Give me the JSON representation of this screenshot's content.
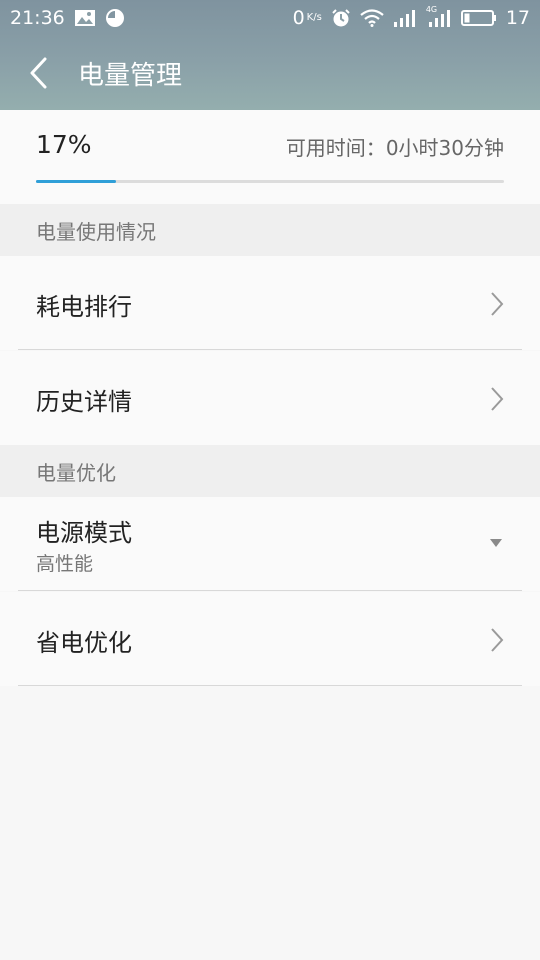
{
  "status_bar": {
    "time": "21:36",
    "net_speed_value": "0",
    "net_speed_unit": "K/s",
    "network_type": "4G",
    "battery_level": "17"
  },
  "toolbar": {
    "title": "电量管理"
  },
  "battery": {
    "percent_text": "17%",
    "remaining_label": "可用时间：",
    "remaining_value": "0小时30分钟",
    "level": 0.17,
    "bar_color": "#2f9fd8"
  },
  "sections": {
    "usage": {
      "header": "电量使用情况",
      "items": [
        {
          "label": "耗电排行"
        },
        {
          "label": "历史详情"
        }
      ]
    },
    "optimize": {
      "header": "电量优化",
      "power_mode": {
        "label": "电源模式",
        "value": "高性能"
      },
      "items": [
        {
          "label": "省电优化"
        }
      ]
    }
  }
}
